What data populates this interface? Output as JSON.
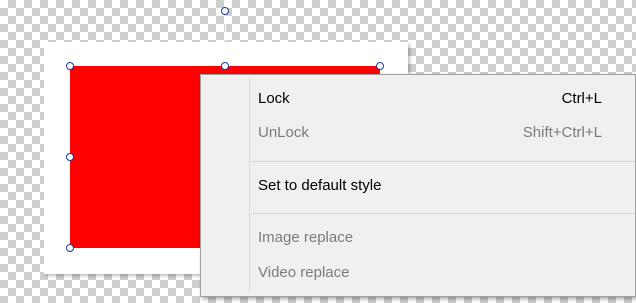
{
  "canvas": {
    "shape_color": "#ff0000",
    "frame_color": "#ffffff",
    "handle_border_color": "#1a3b9c"
  },
  "context_menu": {
    "items": [
      {
        "label": "Lock",
        "shortcut": "Ctrl+L",
        "enabled": true
      },
      {
        "label": "UnLock",
        "shortcut": "Shift+Ctrl+L",
        "enabled": false
      },
      {
        "label": "Set to default style",
        "shortcut": "",
        "enabled": true
      },
      {
        "label": "Image replace",
        "shortcut": "",
        "enabled": false
      },
      {
        "label": "Video replace",
        "shortcut": "",
        "enabled": false
      }
    ]
  }
}
